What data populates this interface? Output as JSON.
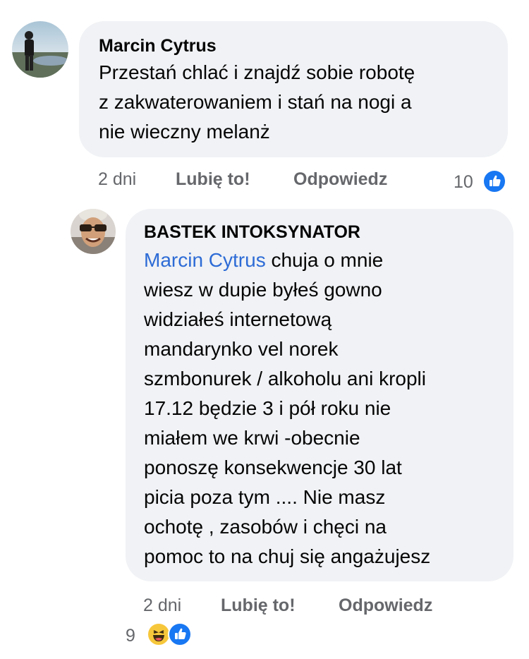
{
  "comments": [
    {
      "author": "Marcin Cytrus",
      "text_lines": [
        "Przestań chlać i znajdź sobie robotę",
        "z zakwaterowaniem i stań na nogi a",
        "nie wieczny melanż"
      ],
      "time": "2 dni",
      "like_label": "Lubię to!",
      "reply_label": "Odpowiedz",
      "reaction_count": "10",
      "reactions": [
        "like-icon"
      ]
    },
    {
      "author": "BASTEK INTOKSYNATOR",
      "mention": "Marcin Cytrus",
      "first_line_rest": " chuja o mnie",
      "text_lines": [
        "wiesz w dupie byłeś gowno",
        "widziałeś internetową",
        "mandarynko vel norek",
        "szmbonurek / alkoholu ani kropli",
        "17.12 będzie 3 i pół roku nie",
        "miałem we krwi -obecnie",
        "ponoszę konsekwencje 30 lat",
        "picia poza tym .... Nie masz",
        "ochotę , zasobów i chęci na",
        "pomoc to na chuj się angażujesz"
      ],
      "time": "2 dni",
      "like_label": "Lubię to!",
      "reply_label": "Odpowiedz",
      "reaction_count": "9",
      "reactions": [
        "haha-icon",
        "like-icon"
      ]
    }
  ],
  "colors": {
    "bubble_bg": "#f0f2f5",
    "meta_text": "#65676b",
    "mention": "#2d6bd6",
    "like_blue": "#1877f2",
    "haha_yellow": "#f7c73b"
  }
}
